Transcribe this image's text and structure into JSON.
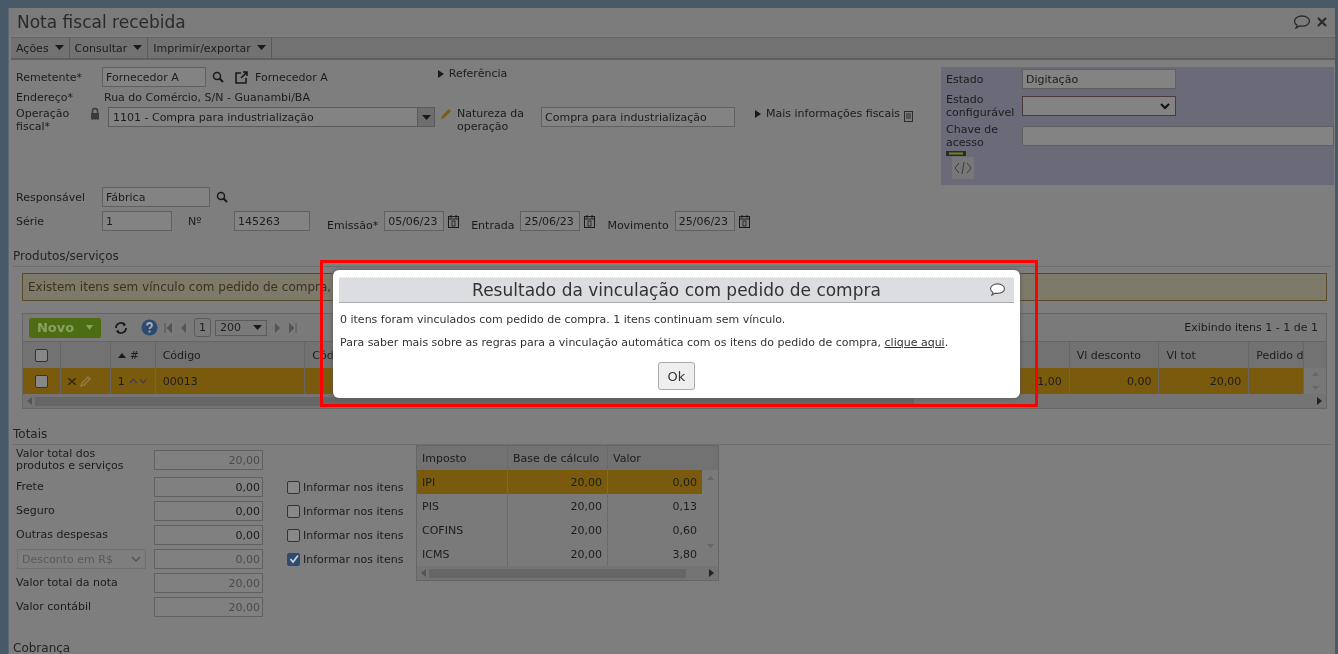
{
  "window": {
    "title": "Nota fiscal recebida"
  },
  "menu": [
    {
      "label": "Ações"
    },
    {
      "label": "Consultar"
    },
    {
      "label": "Imprimir/exportar"
    }
  ],
  "form": {
    "sender": {
      "label": "Remetente*",
      "value": "Fornecedor A",
      "link": "Fornecedor A"
    },
    "reference": {
      "label": "Referência",
      "expanded": false
    },
    "address": {
      "label": "Endereço*",
      "value": "Rua do Comércio, S/N - Guanambi/BA"
    },
    "operation": {
      "label": "Operação fiscal*",
      "value": "1101 - Compra para industrialização"
    },
    "nature": {
      "label": "Natureza da operação",
      "value": "Compra para industrialização"
    },
    "more_info": {
      "label": "Mais informações fiscais",
      "expanded": false
    },
    "responsible": {
      "label": "Responsável",
      "value": "Fábrica"
    },
    "series": {
      "label": "Série",
      "value": "1"
    },
    "number": {
      "label": "Nº",
      "value": "145263"
    },
    "dates": [
      {
        "label": "Emissão*",
        "value": "05/06/23"
      },
      {
        "label": "Entrada",
        "value": "25/06/23"
      },
      {
        "label": "Movimento",
        "value": "25/06/23"
      }
    ]
  },
  "status_panel": {
    "state": {
      "label": "Estado",
      "value": "Digitação"
    },
    "configurable_state": {
      "label": "Estado configurável"
    },
    "access_key": {
      "label": "Chave de acesso"
    }
  },
  "products": {
    "title": "Produtos/serviços",
    "warning": "Existem itens sem vínculo com pedido de compra,",
    "new_button": "Novo",
    "page": "1",
    "page_size": "200",
    "summary": "Exibindo itens 1 - 1 de 1",
    "select_all": {
      "checked": false
    },
    "columns": [
      {
        "label": "#",
        "sorted": true
      },
      {
        "label": "Código",
        "sorted": false
      },
      {
        "label": "Cód",
        "sorted": false
      },
      {
        "label": "Vl desconto",
        "sorted": false
      },
      {
        "label": "Vl tot",
        "sorted": false
      },
      {
        "label": "Pedido d",
        "sorted": false
      }
    ],
    "rows": [
      {
        "checked": false,
        "selected": true,
        "number": "1",
        "code": "00013",
        "column_5": "1,00",
        "discount": "0,00",
        "total": "20,00"
      }
    ]
  },
  "totals": {
    "title": "Totais",
    "fields": [
      {
        "kind": "text",
        "label": "Valor total dos produtos e serviços",
        "value": "20,00",
        "disabled": true
      },
      {
        "kind": "text",
        "label": "Frete",
        "value": "0,00",
        "disabled": false,
        "option": {
          "label": "Informar nos itens",
          "checked": false
        }
      },
      {
        "kind": "text",
        "label": "Seguro",
        "value": "0,00",
        "disabled": false,
        "option": {
          "label": "Informar nos itens",
          "checked": false
        }
      },
      {
        "kind": "text",
        "label": "Outras despesas",
        "value": "0,00",
        "disabled": false,
        "option": {
          "label": "Informar nos itens",
          "checked": false
        }
      },
      {
        "kind": "select",
        "label": "Desconto em R$",
        "value": "0,00",
        "disabled": true,
        "option": {
          "label": "Informar nos itens",
          "checked": true
        }
      },
      {
        "kind": "text",
        "label": "Valor total da nota",
        "value": "20,00",
        "disabled": true
      },
      {
        "kind": "text",
        "label": "Valor contábil",
        "value": "20,00",
        "disabled": true
      }
    ]
  },
  "taxes": {
    "columns": [
      "Imposto",
      "Base de cálculo",
      "Valor"
    ],
    "rows": [
      {
        "tax": "IPI",
        "base": "20,00",
        "value": "0,00",
        "selected": true
      },
      {
        "tax": "PIS",
        "base": "20,00",
        "value": "0,13",
        "selected": false
      },
      {
        "tax": "COFINS",
        "base": "20,00",
        "value": "0,60",
        "selected": false
      },
      {
        "tax": "ICMS",
        "base": "20,00",
        "value": "3,80",
        "selected": false
      }
    ]
  },
  "billing": {
    "title": "Cobrança"
  },
  "dialog": {
    "title": "Resultado da vinculação com pedido de compra",
    "message": "0 itens foram vinculados com pedido de compra. 1 itens continuam sem vínculo.",
    "help": "Para saber mais sobre as regras para a vinculação automática com os itens do pedido de compra,",
    "link": "clique aqui",
    "help_end": ".",
    "button": "Ok"
  }
}
